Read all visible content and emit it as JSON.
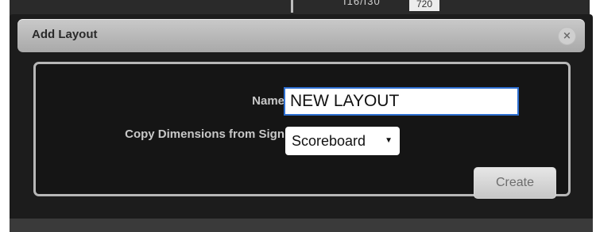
{
  "background": {
    "header_text": "I16/I30",
    "cell_text": "720"
  },
  "dialog": {
    "title": "Add Layout",
    "close_icon": "close-icon",
    "close_symbol": "×",
    "name_label": "Name:",
    "name_value": "NEW LAYOUT",
    "copy_label": "Copy Dimensions from Sign:",
    "copy_selected": "Scoreboard",
    "create_label": "Create"
  },
  "colors": {
    "dialog_background": "#1c1c1c",
    "titlebar": "#b8b8b8",
    "input_border": "#2e6fd1"
  }
}
